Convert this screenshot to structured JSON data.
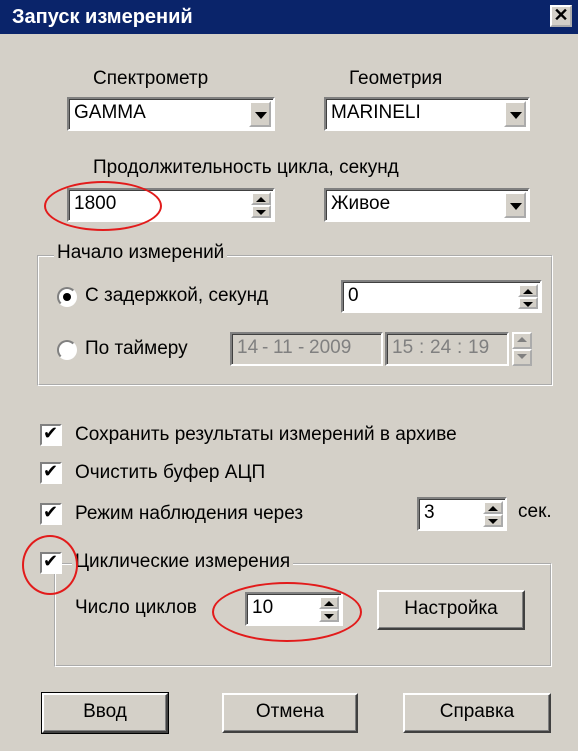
{
  "window": {
    "title": "Запуск измерений",
    "close_glyph": "✕"
  },
  "spectrometer": {
    "label": "Спектрометр",
    "value": "GAMMA"
  },
  "geometry": {
    "label": "Геометрия",
    "value": "MARINELI"
  },
  "cycle_duration": {
    "label": "Продолжительность цикла, секунд",
    "value": "1800",
    "mode": "Живое"
  },
  "start_group": {
    "label": "Начало измерений",
    "delay_label": "С задержкой, секунд",
    "delay_value": "0",
    "timer_label": "По таймеру",
    "date": [
      "14",
      "11",
      "2009"
    ],
    "time": [
      "15",
      "24",
      "19"
    ],
    "sep_date": "-",
    "sep_time": ":",
    "selected": "delay"
  },
  "options": {
    "save_archive": "Сохранить результаты измерений в архиве",
    "clear_buffer": "Очистить буфер АЦП",
    "watch_mode": "Режим наблюдения через",
    "watch_value": "3",
    "watch_unit": "сек."
  },
  "cyclic": {
    "label": "Циклические измерения",
    "count_label": "Число циклов",
    "count_value": "10",
    "settings_button": "Настройка"
  },
  "buttons": {
    "ok": "Ввод",
    "cancel": "Отмена",
    "help": "Справка"
  },
  "colors": {
    "title_bar": "#0a246a",
    "face": "#d4d0c8",
    "annotation": "#e21b1b"
  }
}
